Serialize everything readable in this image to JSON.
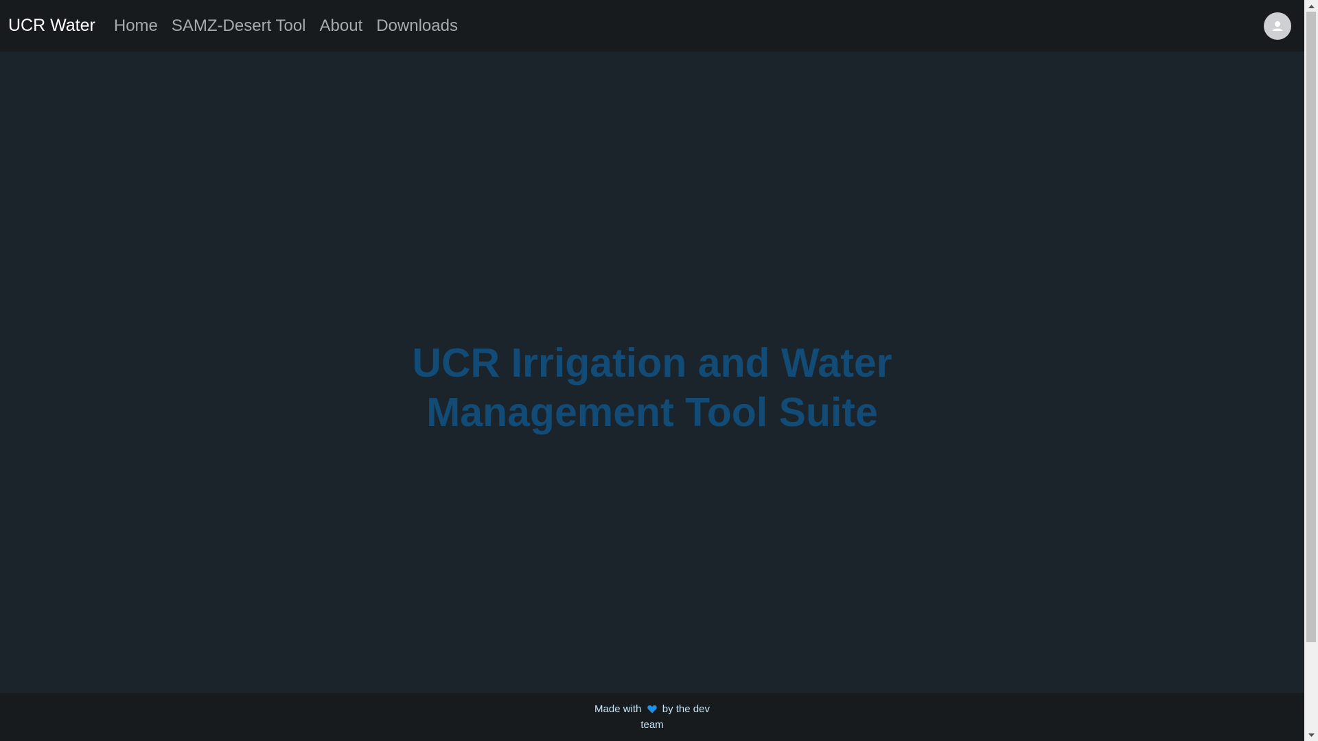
{
  "navbar": {
    "brand": "UCR Water",
    "links": [
      "Home",
      "SAMZ-Desert Tool",
      "About",
      "Downloads"
    ],
    "avatar_icon": "user-avatar-icon"
  },
  "hero": {
    "title": "UCR Irrigation and Water Management Tool Suite"
  },
  "footer": {
    "text_before": "Made with",
    "icon": "heart-icon",
    "text_after": "by the dev team"
  },
  "colors": {
    "navbar_bg": "#181b1e",
    "page_bg": "#1b242b",
    "title": "#114b76",
    "heart": "#1e90e6",
    "footer_text": "#c8e6f7"
  }
}
